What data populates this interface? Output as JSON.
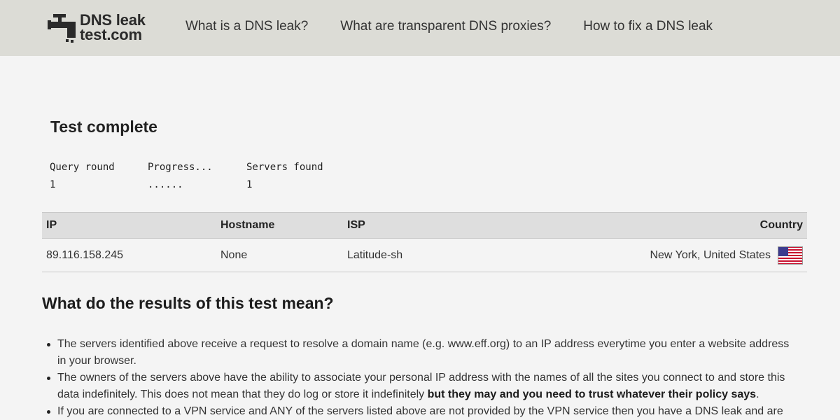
{
  "header": {
    "logo_line1": "DNS leak",
    "logo_line2": "test.com",
    "nav": [
      {
        "label": "What is a DNS leak?"
      },
      {
        "label": "What are transparent DNS proxies?"
      },
      {
        "label": "How to fix a DNS leak"
      }
    ]
  },
  "test": {
    "title": "Test complete",
    "stats": {
      "query_round_label": "Query round",
      "query_round_value": "1",
      "progress_label": "Progress...",
      "progress_value": "......",
      "servers_found_label": "Servers found",
      "servers_found_value": "1"
    }
  },
  "results_table": {
    "headers": {
      "ip": "IP",
      "hostname": "Hostname",
      "isp": "ISP",
      "country": "Country"
    },
    "rows": [
      {
        "ip": "89.116.158.245",
        "hostname": "None",
        "isp": "Latitude-sh",
        "country": "New York, United States",
        "flag_icon": "us-flag-icon"
      }
    ]
  },
  "explanation": {
    "heading": "What do the results of this test mean?",
    "bullet1": "The servers identified above receive a request to resolve a domain name (e.g. www.eff.org) to an IP address everytime you enter a website address in your browser.",
    "bullet2_normal": "The owners of the servers above have the ability to associate your personal IP address with the names of all the sites you connect to and store this data indefinitely. This does not mean that they do log or store it indefinitely ",
    "bullet2_bold": "but they may and you need to trust whatever their policy says",
    "bullet2_end": ".",
    "bullet3": "If you are connected to a VPN service and ANY of the servers listed above are not provided by the VPN service then you have a DNS leak and are"
  },
  "colors": {
    "header_bg": "#dcdcd6",
    "page_bg": "#f4f4f4",
    "table_header_bg": "#dedede"
  }
}
